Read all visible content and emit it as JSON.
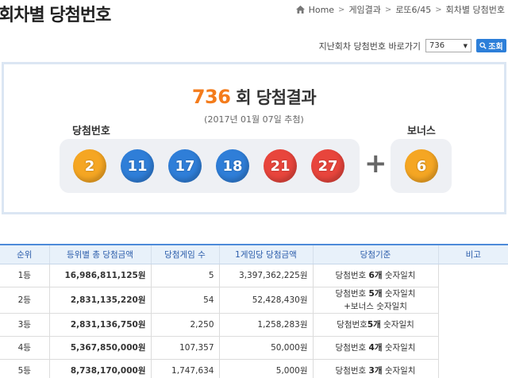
{
  "page": {
    "title": "회차별 당첨번호",
    "breadcrumb": [
      "Home",
      "게임결과",
      "로또6/45",
      "회차별 당첨번호"
    ]
  },
  "goto": {
    "label": "지난회차 당첨번호 바로가기",
    "selected_round": "736",
    "button_label": "조회"
  },
  "result": {
    "round": "736",
    "round_suffix": "회 당첨결과",
    "date": "(2017년 01월 07일 추첨)",
    "winning_label": "당첨번호",
    "bonus_label": "보너스",
    "numbers": [
      "2",
      "11",
      "17",
      "18",
      "21",
      "27"
    ],
    "bonus": "6",
    "ball_colors": {
      "yellow": "#f5a623",
      "blue": "#2f7ed8",
      "red": "#e8453c"
    }
  },
  "table": {
    "headers": [
      "순위",
      "등위별 총 당첨금액",
      "당첨게임 수",
      "1게임당 당첨금액",
      "당첨기준",
      "비고"
    ],
    "rows": [
      {
        "rank": "1등",
        "total": "16,986,811,125원",
        "count": "5",
        "per_game": "3,397,362,225원",
        "criteria_pre": "당첨번호 ",
        "criteria_bold": "6개",
        "criteria_post": " 숫자일치",
        "criteria_line2": ""
      },
      {
        "rank": "2등",
        "total": "2,831,135,220원",
        "count": "54",
        "per_game": "52,428,430원",
        "criteria_pre": "당첨번호 ",
        "criteria_bold": "5개",
        "criteria_post": " 숫자일치",
        "criteria_line2": "+보너스 숫자일치"
      },
      {
        "rank": "3등",
        "total": "2,831,136,750원",
        "count": "2,250",
        "per_game": "1,258,283원",
        "criteria_pre": "당첨번호",
        "criteria_bold": "5개",
        "criteria_post": " 숫자일치",
        "criteria_line2": ""
      },
      {
        "rank": "4등",
        "total": "5,367,850,000원",
        "count": "107,357",
        "per_game": "50,000원",
        "criteria_pre": "당첨번호 ",
        "criteria_bold": "4개",
        "criteria_post": " 숫자일치",
        "criteria_line2": ""
      },
      {
        "rank": "5등",
        "total": "8,738,170,000원",
        "count": "1,747,634",
        "per_game": "5,000원",
        "criteria_pre": "당첨번호 ",
        "criteria_bold": "3개",
        "criteria_post": " 숫자일치",
        "criteria_line2": ""
      }
    ]
  }
}
